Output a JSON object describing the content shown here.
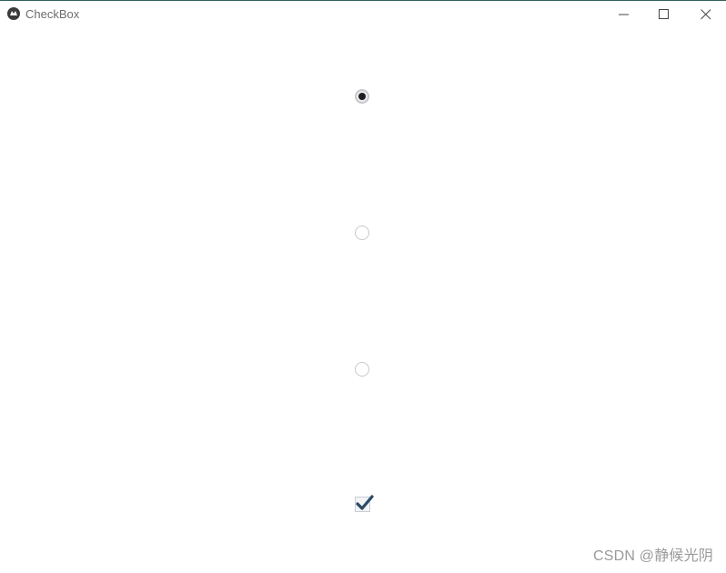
{
  "window": {
    "title": "CheckBox",
    "icon": "kivy-logo-icon"
  },
  "controls": {
    "minimize_icon": "minimize-icon",
    "maximize_icon": "maximize-icon",
    "close_icon": "close-icon"
  },
  "radios": [
    {
      "checked": true
    },
    {
      "checked": false
    },
    {
      "checked": false
    }
  ],
  "checkbox": {
    "checked": true,
    "check_color": "#2b4a66"
  },
  "watermark": "CSDN @静候光阴"
}
